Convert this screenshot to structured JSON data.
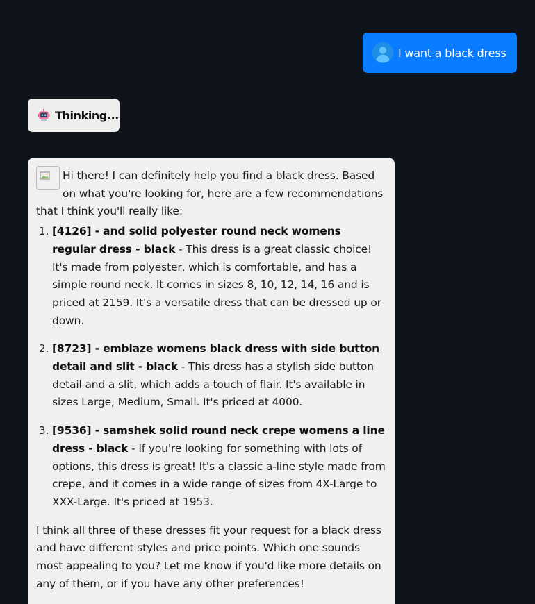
{
  "user_message": {
    "text": "I want a black dress",
    "avatar_icon": "user-avatar-icon"
  },
  "thinking": {
    "label": "Thinking...",
    "icon": "robot-icon"
  },
  "assistant_message": {
    "avatar_icon": "bot-avatar-icon",
    "intro": "Hi there! I can definitely help you find a black dress. Based on what you're looking for, here are a few recommendations that I think you'll really like:",
    "recommendations": [
      {
        "title": "[4126] - and solid polyester round neck womens regular dress - black",
        "description": " - This dress is a great classic choice! It's made from polyester, which is comfortable, and has a simple round neck. It comes in sizes 8, 10, 12, 14, 16 and is priced at 2159. It's a versatile dress that can be dressed up or down."
      },
      {
        "title": "[8723] - emblaze womens black dress with side button detail and slit - black",
        "description": " - This dress has a stylish side button detail and a slit, which adds a touch of flair. It's available in sizes Large, Medium, Small. It's priced at 4000."
      },
      {
        "title": "[9536] - samshek solid round neck crepe womens a line dress - black",
        "description": " - If you're looking for something with lots of options, this dress is great! It's a classic a-line style made from crepe, and it comes in a wide range of sizes from 4X-Large to XXX-Large. It's priced at 1953."
      }
    ],
    "outro": "I think all three of these dresses fit your request for a black dress and have different styles and price points. Which one sounds most appealing to you? Let me know if you'd like more details on any of them, or if you have any other preferences!"
  },
  "colors": {
    "background": "#0f131a",
    "user_bubble": "#0a7cff",
    "assistant_bubble": "#f0f0f0"
  }
}
